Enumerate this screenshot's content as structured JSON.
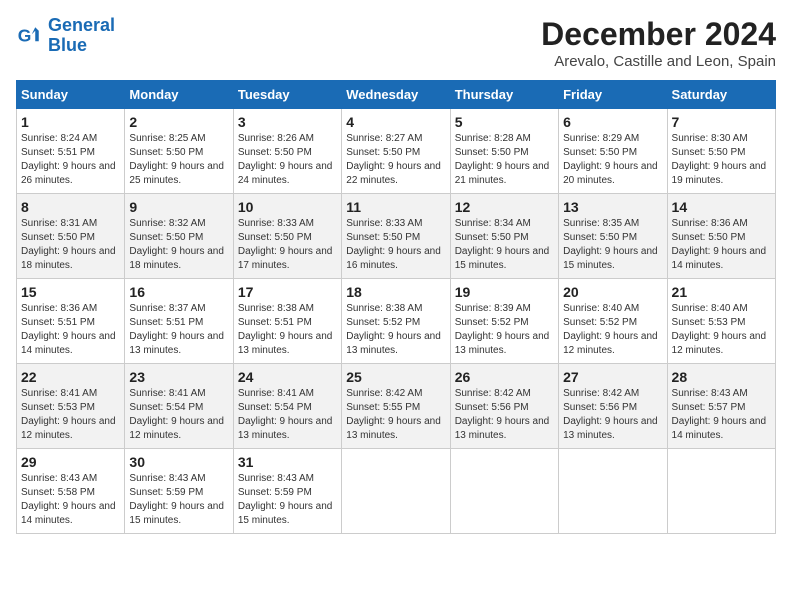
{
  "header": {
    "logo_line1": "General",
    "logo_line2": "Blue",
    "main_title": "December 2024",
    "subtitle": "Arevalo, Castille and Leon, Spain"
  },
  "days_of_week": [
    "Sunday",
    "Monday",
    "Tuesday",
    "Wednesday",
    "Thursday",
    "Friday",
    "Saturday"
  ],
  "weeks": [
    [
      {
        "day": "1",
        "info": "Sunrise: 8:24 AM\nSunset: 5:51 PM\nDaylight: 9 hours and 26 minutes."
      },
      {
        "day": "2",
        "info": "Sunrise: 8:25 AM\nSunset: 5:50 PM\nDaylight: 9 hours and 25 minutes."
      },
      {
        "day": "3",
        "info": "Sunrise: 8:26 AM\nSunset: 5:50 PM\nDaylight: 9 hours and 24 minutes."
      },
      {
        "day": "4",
        "info": "Sunrise: 8:27 AM\nSunset: 5:50 PM\nDaylight: 9 hours and 22 minutes."
      },
      {
        "day": "5",
        "info": "Sunrise: 8:28 AM\nSunset: 5:50 PM\nDaylight: 9 hours and 21 minutes."
      },
      {
        "day": "6",
        "info": "Sunrise: 8:29 AM\nSunset: 5:50 PM\nDaylight: 9 hours and 20 minutes."
      },
      {
        "day": "7",
        "info": "Sunrise: 8:30 AM\nSunset: 5:50 PM\nDaylight: 9 hours and 19 minutes."
      }
    ],
    [
      {
        "day": "8",
        "info": "Sunrise: 8:31 AM\nSunset: 5:50 PM\nDaylight: 9 hours and 18 minutes."
      },
      {
        "day": "9",
        "info": "Sunrise: 8:32 AM\nSunset: 5:50 PM\nDaylight: 9 hours and 18 minutes."
      },
      {
        "day": "10",
        "info": "Sunrise: 8:33 AM\nSunset: 5:50 PM\nDaylight: 9 hours and 17 minutes."
      },
      {
        "day": "11",
        "info": "Sunrise: 8:33 AM\nSunset: 5:50 PM\nDaylight: 9 hours and 16 minutes."
      },
      {
        "day": "12",
        "info": "Sunrise: 8:34 AM\nSunset: 5:50 PM\nDaylight: 9 hours and 15 minutes."
      },
      {
        "day": "13",
        "info": "Sunrise: 8:35 AM\nSunset: 5:50 PM\nDaylight: 9 hours and 15 minutes."
      },
      {
        "day": "14",
        "info": "Sunrise: 8:36 AM\nSunset: 5:50 PM\nDaylight: 9 hours and 14 minutes."
      }
    ],
    [
      {
        "day": "15",
        "info": "Sunrise: 8:36 AM\nSunset: 5:51 PM\nDaylight: 9 hours and 14 minutes."
      },
      {
        "day": "16",
        "info": "Sunrise: 8:37 AM\nSunset: 5:51 PM\nDaylight: 9 hours and 13 minutes."
      },
      {
        "day": "17",
        "info": "Sunrise: 8:38 AM\nSunset: 5:51 PM\nDaylight: 9 hours and 13 minutes."
      },
      {
        "day": "18",
        "info": "Sunrise: 8:38 AM\nSunset: 5:52 PM\nDaylight: 9 hours and 13 minutes."
      },
      {
        "day": "19",
        "info": "Sunrise: 8:39 AM\nSunset: 5:52 PM\nDaylight: 9 hours and 13 minutes."
      },
      {
        "day": "20",
        "info": "Sunrise: 8:40 AM\nSunset: 5:52 PM\nDaylight: 9 hours and 12 minutes."
      },
      {
        "day": "21",
        "info": "Sunrise: 8:40 AM\nSunset: 5:53 PM\nDaylight: 9 hours and 12 minutes."
      }
    ],
    [
      {
        "day": "22",
        "info": "Sunrise: 8:41 AM\nSunset: 5:53 PM\nDaylight: 9 hours and 12 minutes."
      },
      {
        "day": "23",
        "info": "Sunrise: 8:41 AM\nSunset: 5:54 PM\nDaylight: 9 hours and 12 minutes."
      },
      {
        "day": "24",
        "info": "Sunrise: 8:41 AM\nSunset: 5:54 PM\nDaylight: 9 hours and 13 minutes."
      },
      {
        "day": "25",
        "info": "Sunrise: 8:42 AM\nSunset: 5:55 PM\nDaylight: 9 hours and 13 minutes."
      },
      {
        "day": "26",
        "info": "Sunrise: 8:42 AM\nSunset: 5:56 PM\nDaylight: 9 hours and 13 minutes."
      },
      {
        "day": "27",
        "info": "Sunrise: 8:42 AM\nSunset: 5:56 PM\nDaylight: 9 hours and 13 minutes."
      },
      {
        "day": "28",
        "info": "Sunrise: 8:43 AM\nSunset: 5:57 PM\nDaylight: 9 hours and 14 minutes."
      }
    ],
    [
      {
        "day": "29",
        "info": "Sunrise: 8:43 AM\nSunset: 5:58 PM\nDaylight: 9 hours and 14 minutes."
      },
      {
        "day": "30",
        "info": "Sunrise: 8:43 AM\nSunset: 5:59 PM\nDaylight: 9 hours and 15 minutes."
      },
      {
        "day": "31",
        "info": "Sunrise: 8:43 AM\nSunset: 5:59 PM\nDaylight: 9 hours and 15 minutes."
      },
      null,
      null,
      null,
      null
    ]
  ]
}
